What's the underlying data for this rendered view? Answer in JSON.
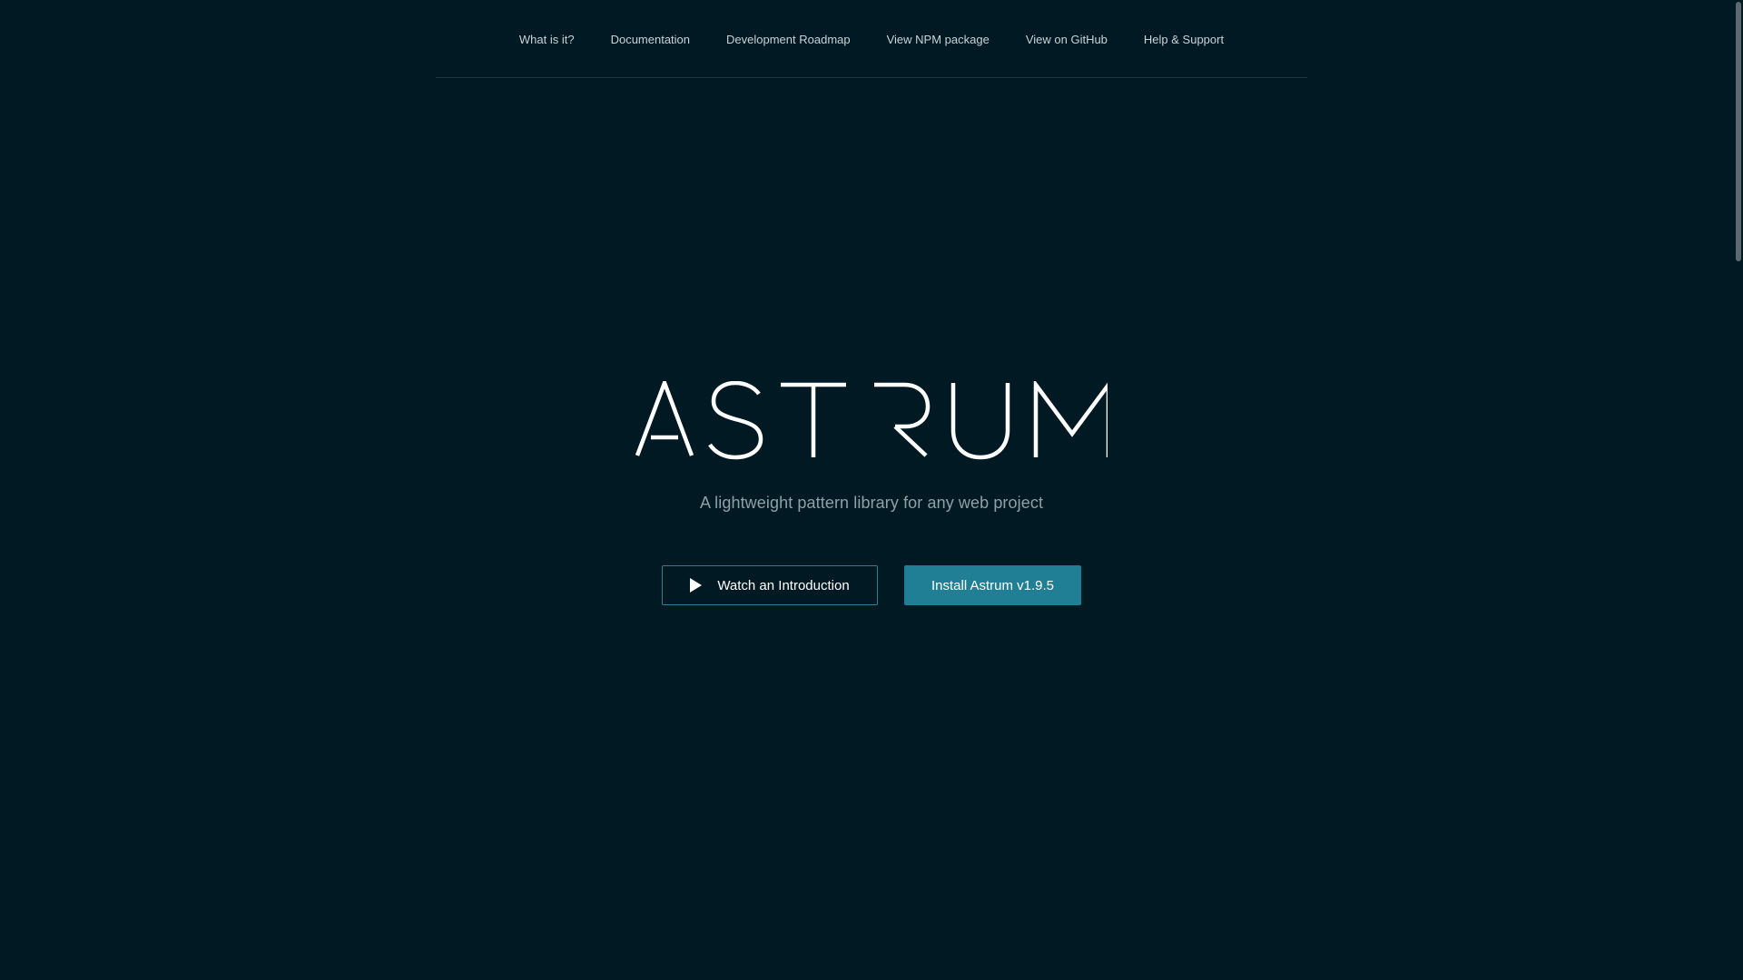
{
  "nav": {
    "items": [
      {
        "label": "What is it?"
      },
      {
        "label": "Documentation"
      },
      {
        "label": "Development Roadmap"
      },
      {
        "label": "View NPM package"
      },
      {
        "label": "View on GitHub"
      },
      {
        "label": "Help & Support"
      }
    ]
  },
  "hero": {
    "logo_text": "ASTRUM",
    "tagline": "A lightweight pattern library for any web project"
  },
  "actions": {
    "watch_label": "Watch an Introduction",
    "watch_icon": "play-icon",
    "install_label": "Install Astrum v1.9.5"
  },
  "colors": {
    "background": "#011923",
    "accent": "#217f95",
    "nav_text": "#c9d3d8",
    "tagline_text": "#8ea0a8"
  }
}
